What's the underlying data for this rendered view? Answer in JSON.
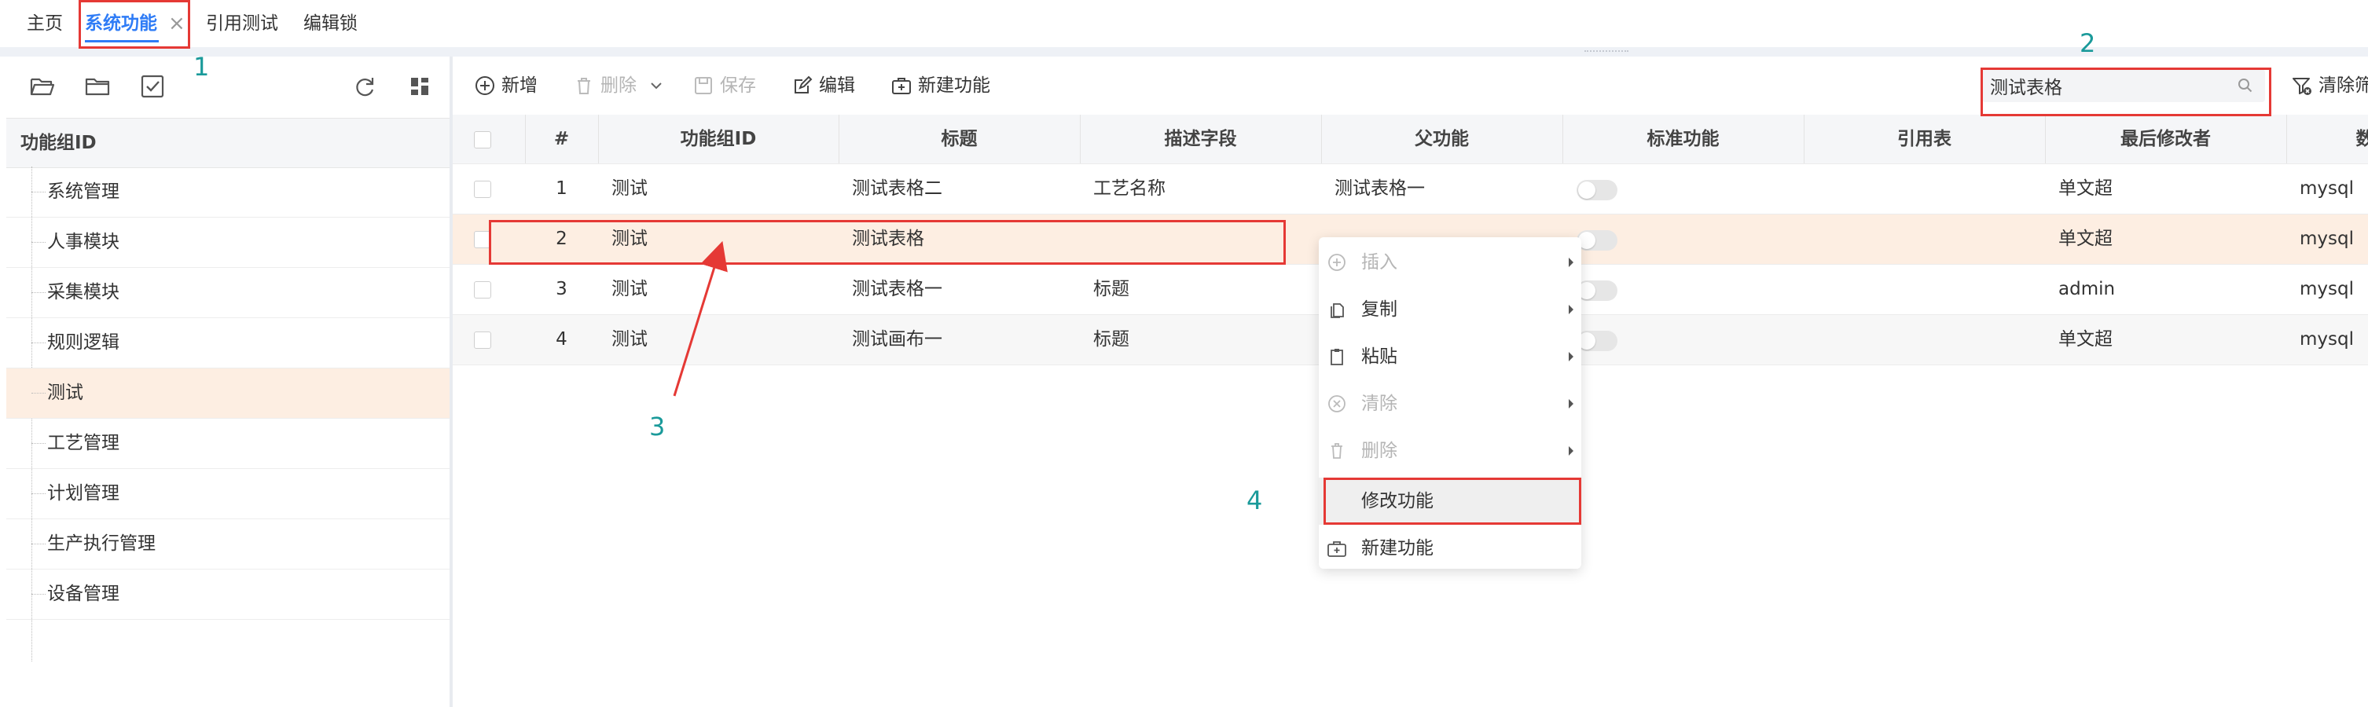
{
  "tabs": [
    {
      "label": "主页",
      "active": false
    },
    {
      "label": "系统功能",
      "active": true,
      "closable": true
    },
    {
      "label": "引用测试",
      "active": false
    },
    {
      "label": "编辑锁",
      "active": false
    }
  ],
  "left_panel": {
    "toolbar_icons": [
      "open-folder-icon",
      "folder-icon",
      "checkbox-icon",
      "refresh-icon",
      "grid-layout-icon"
    ],
    "column_header": "功能组ID",
    "tree_items": [
      "系统管理",
      "人事模块",
      "采集模块",
      "规则逻辑",
      "测试",
      "工艺管理",
      "计划管理",
      "生产执行管理",
      "设备管理"
    ],
    "selected_index": 4
  },
  "toolbar": {
    "add": "新增",
    "delete": "删除",
    "save": "保存",
    "edit": "编辑",
    "new_function": "新建功能",
    "search_value": "测试表格",
    "clear_filter": "清除筛"
  },
  "grid": {
    "headers": [
      "#",
      "功能组ID",
      "标题",
      "描述字段",
      "父功能",
      "标准功能",
      "引用表",
      "最后修改者",
      "数"
    ],
    "rows": [
      {
        "num": "1",
        "group": "测试",
        "title": "测试表格二",
        "desc": "工艺名称",
        "parent": "测试表格一",
        "standard": false,
        "ref": "",
        "modifier": "单文超",
        "db": "mysql"
      },
      {
        "num": "2",
        "group": "测试",
        "title": "测试表格",
        "desc": "",
        "parent": "",
        "standard": false,
        "ref": "",
        "modifier": "单文超",
        "db": "mysql"
      },
      {
        "num": "3",
        "group": "测试",
        "title": "测试表格一",
        "desc": "标题",
        "parent": "",
        "standard": false,
        "ref": "",
        "modifier": "admin",
        "db": "mysql"
      },
      {
        "num": "4",
        "group": "测试",
        "title": "测试画布一",
        "desc": "标题",
        "parent": "",
        "standard": false,
        "ref": "",
        "modifier": "单文超",
        "db": "mysql"
      }
    ],
    "highlighted_row": 2
  },
  "context_menu": {
    "items": [
      {
        "label": "插入",
        "icon": "plus-circle-icon",
        "disabled": true,
        "submenu": true
      },
      {
        "label": "复制",
        "icon": "copy-icon",
        "disabled": false,
        "submenu": true
      },
      {
        "label": "粘贴",
        "icon": "paste-icon",
        "disabled": false,
        "submenu": true
      },
      {
        "label": "清除",
        "icon": "clear-circle-icon",
        "disabled": true,
        "submenu": true
      },
      {
        "label": "删除",
        "icon": "trash-icon",
        "disabled": true,
        "submenu": true
      },
      {
        "label": "修改功能",
        "icon": "",
        "disabled": false,
        "submenu": false
      },
      {
        "label": "新建功能",
        "icon": "new-function-icon",
        "disabled": false,
        "submenu": false
      }
    ]
  },
  "annotations": {
    "a1": "1",
    "a2": "2",
    "a3": "3",
    "a4": "4"
  },
  "colors": {
    "accent": "#2f7cf6",
    "highlight_row": "#fdeee2",
    "annotation_red": "#e53935",
    "annotation_teal": "#1a9a9a"
  }
}
